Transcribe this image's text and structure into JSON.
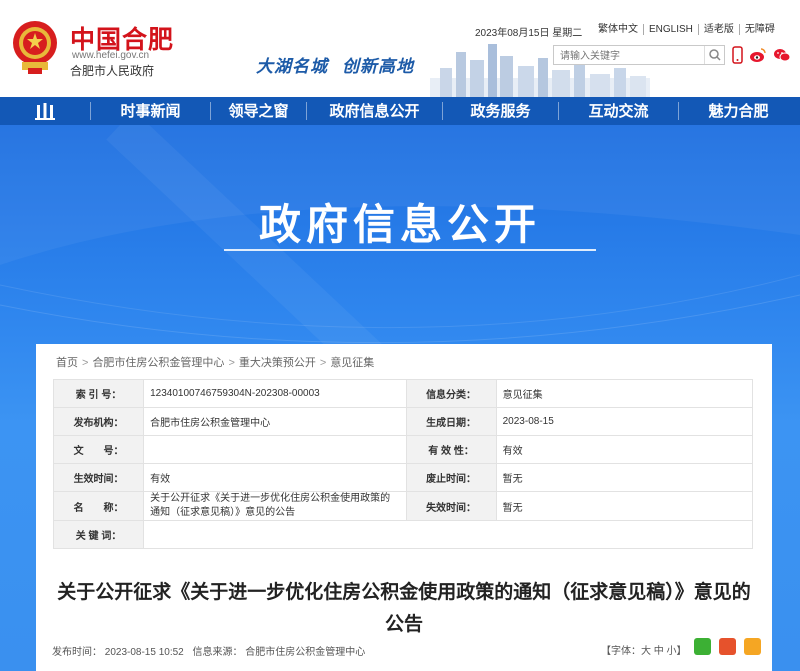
{
  "header": {
    "site_title": "中国合肥",
    "site_url": "www.hefei.gov.cn",
    "site_subtitle": "合肥市人民政府",
    "slogan_part1": "大湖名城",
    "slogan_part2": "创新高地",
    "date": "2023年08月15日 星期二",
    "links": [
      "繁体中文",
      "ENGLISH",
      "适老版",
      "无障碍"
    ],
    "search_placeholder": "请输入关键字"
  },
  "nav": {
    "items": [
      "时事新闻",
      "领导之窗",
      "政府信息公开",
      "政务服务",
      "互动交流",
      "魅力合肥"
    ]
  },
  "banner": {
    "title": "政府信息公开"
  },
  "breadcrumb": [
    "首页",
    "合肥市住房公积金管理中心",
    "重大决策预公开",
    "意见征集"
  ],
  "info": {
    "index_label": "索 引 号：",
    "index_value": "12340100746759304N-202308-00003",
    "category_label": "信息分类：",
    "category_value": "意见征集",
    "publisher_label": "发布机构：",
    "publisher_value": "合肥市住房公积金管理中心",
    "gen_date_label": "生成日期：",
    "gen_date_value": "2023-08-15",
    "doc_no_label": "文　　号：",
    "doc_no_value": "",
    "validity_label": "有 效 性：",
    "validity_value": "有效",
    "effective_label": "生效时间：",
    "effective_value": "有效",
    "repeal_label": "废止时间：",
    "repeal_value": "暂无",
    "name_label": "名　　称：",
    "name_value": "关于公开征求《关于进一步优化住房公积金使用政策的通知（征求意见稿）》意见的公告",
    "expire_label": "失效时间：",
    "expire_value": "暂无",
    "keywords_label": "关 键 词：",
    "keywords_value": ""
  },
  "article": {
    "title": "关于公开征求《关于进一步优化住房公积金使用政策的通知（征求意见稿）》意见的公告",
    "publish_time": "发布时间： 2023-08-15 10:52",
    "source": "信息来源： 合肥市住房公积金管理中心",
    "font_size": "【字体：大 中 小】"
  },
  "colors": {
    "brand_red": "#d3131b",
    "nav_blue": "#1358b6",
    "banner_blue": "#2f86ee"
  }
}
